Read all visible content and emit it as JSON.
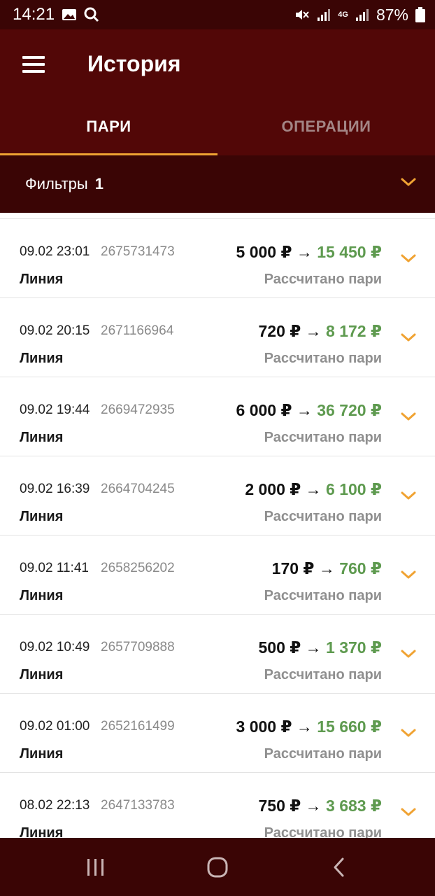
{
  "status_bar": {
    "time": "14:21",
    "battery_percent": "87%",
    "network": "4G"
  },
  "header": {
    "title": "История"
  },
  "tabs": [
    {
      "label": "ПАРИ",
      "active": true
    },
    {
      "label": "ОПЕРАЦИИ",
      "active": false
    }
  ],
  "filters": {
    "label": "Фильтры",
    "count": "1"
  },
  "bets": [
    {
      "date": "09.02 23:01",
      "id": "2675731473",
      "stake": "5 000 ₽",
      "arrow": "→",
      "win": "15 450 ₽",
      "type": "Линия",
      "status": "Рассчитано пари"
    },
    {
      "date": "09.02 20:15",
      "id": "2671166964",
      "stake": "720 ₽",
      "arrow": "→",
      "win": "8 172 ₽",
      "type": "Линия",
      "status": "Рассчитано пари"
    },
    {
      "date": "09.02 19:44",
      "id": "2669472935",
      "stake": "6 000 ₽",
      "arrow": "→",
      "win": "36 720 ₽",
      "type": "Линия",
      "status": "Рассчитано пари"
    },
    {
      "date": "09.02 16:39",
      "id": "2664704245",
      "stake": "2 000 ₽",
      "arrow": "→",
      "win": "6 100 ₽",
      "type": "Линия",
      "status": "Рассчитано пари"
    },
    {
      "date": "09.02 11:41",
      "id": "2658256202",
      "stake": "170 ₽",
      "arrow": "→",
      "win": "760 ₽",
      "type": "Линия",
      "status": "Рассчитано пари"
    },
    {
      "date": "09.02 10:49",
      "id": "2657709888",
      "stake": "500 ₽",
      "arrow": "→",
      "win": "1 370 ₽",
      "type": "Линия",
      "status": "Рассчитано пари"
    },
    {
      "date": "09.02 01:00",
      "id": "2652161499",
      "stake": "3 000 ₽",
      "arrow": "→",
      "win": "15 660 ₽",
      "type": "Линия",
      "status": "Рассчитано пари"
    },
    {
      "date": "08.02 22:13",
      "id": "2647133783",
      "stake": "750 ₽",
      "arrow": "→",
      "win": "3 683 ₽",
      "type": "Линия",
      "status": "Рассчитано пари"
    }
  ],
  "colors": {
    "header_bg": "#520707",
    "dark_bg": "#3a0505",
    "accent": "#f0a333",
    "win_green": "#5e9a4f",
    "muted_text": "#8f8f8f"
  },
  "icons": {
    "menu": "hamburger-icon",
    "expand": "chevron-down-icon",
    "nav_recent": "recent-apps-icon",
    "nav_home": "home-icon",
    "nav_back": "back-icon"
  }
}
